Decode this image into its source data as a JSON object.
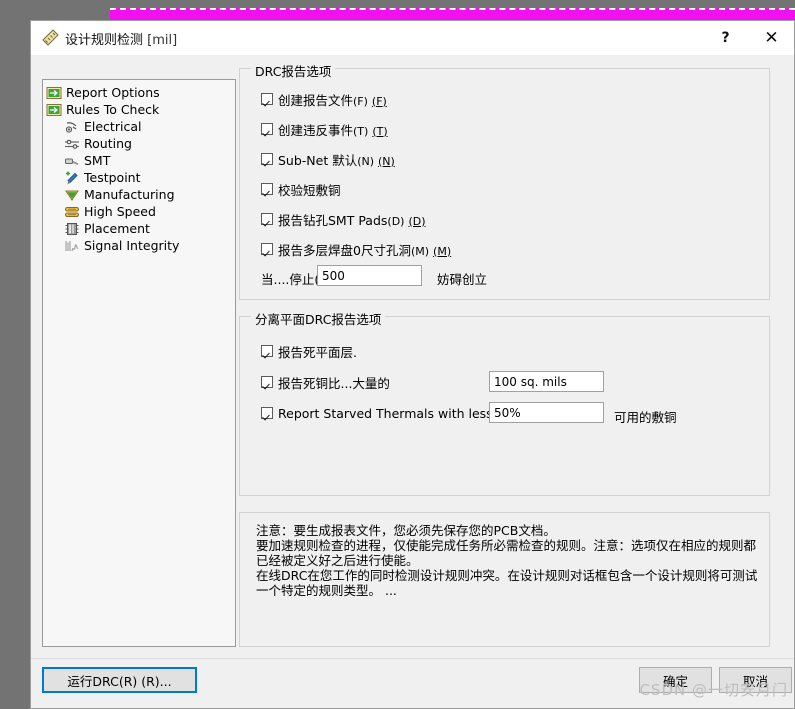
{
  "window": {
    "title": "设计规则检测",
    "unit": "[mil]",
    "icon": "ruler-icon",
    "help_label": "?",
    "close_label": "✕"
  },
  "sidebar": {
    "items": [
      {
        "label": "Report Options",
        "icon": "report-options-icon",
        "level": 0
      },
      {
        "label": "Rules To Check",
        "icon": "rules-to-check-icon",
        "level": 0
      },
      {
        "label": "Electrical",
        "icon": "electrical-icon",
        "level": 1
      },
      {
        "label": "Routing",
        "icon": "routing-icon",
        "level": 1
      },
      {
        "label": "SMT",
        "icon": "smt-icon",
        "level": 1
      },
      {
        "label": "Testpoint",
        "icon": "testpoint-icon",
        "level": 1
      },
      {
        "label": "Manufacturing",
        "icon": "manufacturing-icon",
        "level": 1
      },
      {
        "label": "High Speed",
        "icon": "high-speed-icon",
        "level": 1
      },
      {
        "label": "Placement",
        "icon": "placement-icon",
        "level": 1
      },
      {
        "label": "Signal Integrity",
        "icon": "signal-integrity-icon",
        "level": 1
      }
    ]
  },
  "drc_report": {
    "title": "DRC报告选项",
    "options": [
      {
        "label": "创建报告文件",
        "mnemonic": "(F)",
        "accel": "(F)",
        "checked": true
      },
      {
        "label": "创建违反事件",
        "mnemonic": "(T)",
        "accel": "(T)",
        "checked": true
      },
      {
        "label": "Sub-Net 默认",
        "mnemonic": "(N)",
        "accel": "(N)",
        "checked": true
      },
      {
        "label": "校验短敷铜",
        "mnemonic": "",
        "accel": "",
        "checked": true
      },
      {
        "label": "报告钻孔SMT Pads",
        "mnemonic": "(D)",
        "accel": "(D)",
        "checked": true
      },
      {
        "label": "报告多层焊盘0尺寸孔洞",
        "mnemonic": "(M)",
        "accel": "(M)",
        "checked": true
      }
    ],
    "stop_label": "当....停止(B",
    "stop_value": "500",
    "stop_suffix": "妨碍创立"
  },
  "split_plane": {
    "title": "分离平面DRC报告选项",
    "rows": [
      {
        "label": "报告死平面层.",
        "checked": true,
        "value": null,
        "suffix": ""
      },
      {
        "label": "报告死铜比...大量的",
        "checked": true,
        "value": "100 sq. mils",
        "suffix": ""
      },
      {
        "label": "Report Starved Thermals with less than",
        "checked": true,
        "value": "50%",
        "suffix": "可用的敷铜"
      }
    ]
  },
  "note": {
    "text": "注意：要生成报表文件，您必须先保存您的PCB文档。\n要加速规则检查的进程，仅使能完成任务所必需检查的规则。注意：选项仅在相应的规则都已经被定义好之后进行使能。\n在线DRC在您工作的同时检测设计规则冲突。在设计规则对话框包含一个设计规则将可测试一个特定的规则类型。 ..."
  },
  "footer": {
    "run_drc_label": "运行DRC(R) (R)...",
    "ok_label": "确定",
    "cancel_label": "取消",
    "watermark": "CSDN @一切安月门"
  },
  "colors": {
    "dialog_bg": "#f0f0f0",
    "accent": "#0078d7",
    "selection_band": "#f010f0",
    "tree_bg": "#f7f7f7"
  }
}
